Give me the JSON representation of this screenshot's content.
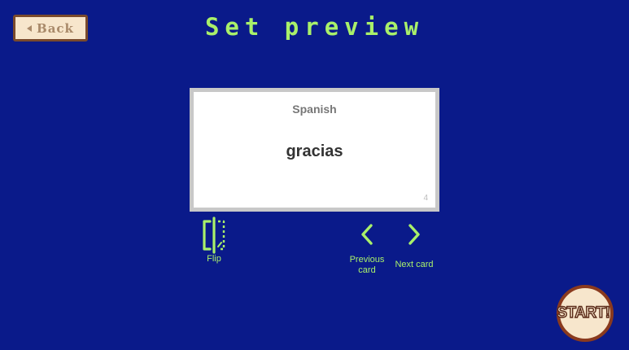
{
  "header": {
    "back_label": "Back",
    "title": "Set preview"
  },
  "card": {
    "language": "Spanish",
    "word": "gracias",
    "number": "4"
  },
  "controls": {
    "flip_label": "Flip",
    "previous_label": "Previous card",
    "next_label": "Next card"
  },
  "start": {
    "label": "START!"
  },
  "icons": {
    "back": "back-arrow-icon",
    "flip": "flip-icon",
    "previous": "chevron-left-icon",
    "next": "chevron-right-icon"
  },
  "colors": {
    "background": "#0a1a8a",
    "accent": "#a9f06a",
    "button_fill": "#f7e6cc",
    "button_border": "#7a4a2c",
    "start_border": "#8a3a1e",
    "card_fill": "#ffffff",
    "card_border": "#c8c8c8"
  }
}
